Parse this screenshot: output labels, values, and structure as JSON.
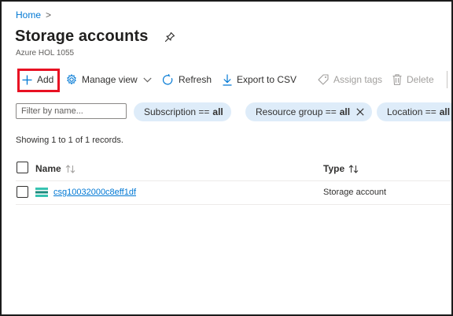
{
  "breadcrumb": {
    "home": "Home",
    "separator": ">"
  },
  "header": {
    "title": "Storage accounts",
    "subtitle": "Azure HOL 1055",
    "pin_icon": "pin-icon"
  },
  "toolbar": {
    "add": "Add",
    "manage_view": "Manage view",
    "refresh": "Refresh",
    "export_csv": "Export to CSV",
    "assign_tags": "Assign tags",
    "delete": "Delete"
  },
  "filters": {
    "search_placeholder": "Filter by name...",
    "chips": [
      {
        "label": "Subscription ==",
        "value": "all"
      },
      {
        "label": "Resource group ==",
        "value": "all"
      },
      {
        "label": "Location ==",
        "value": "all"
      }
    ]
  },
  "records_text": "Showing 1 to 1 of 1 records.",
  "table": {
    "columns": [
      "Name",
      "Type"
    ],
    "rows": [
      {
        "name": "csg10032000c8eff1df",
        "type": "Storage account"
      }
    ]
  },
  "colors": {
    "accent": "#0078d4",
    "chip_bg": "#deecf9",
    "highlight": "#e81123"
  }
}
